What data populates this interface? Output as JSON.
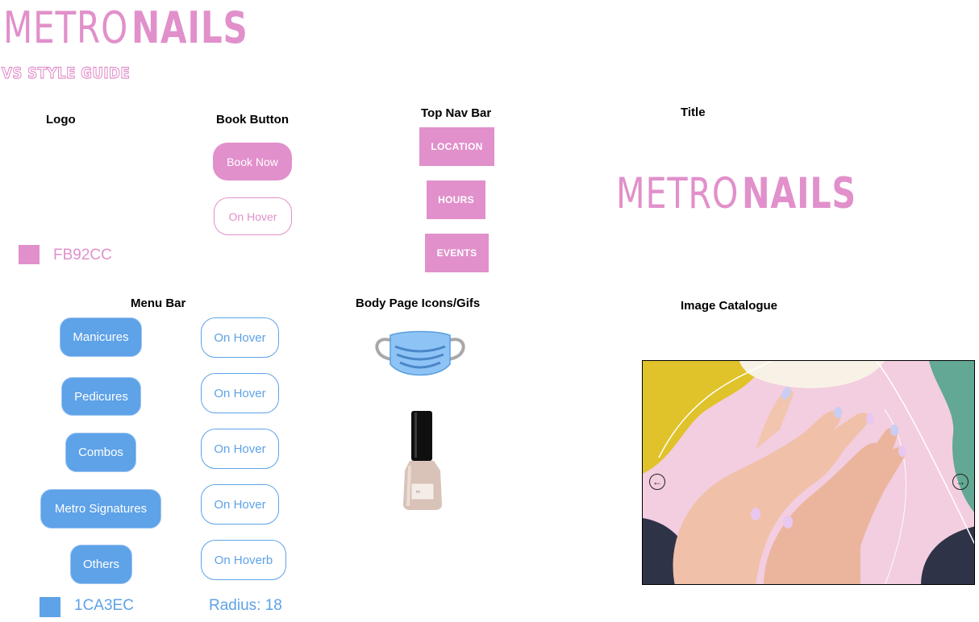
{
  "brand": {
    "logo_thin": "METRO",
    "logo_bold": "NAILS",
    "subtitle": "VS STYLE GUIDE"
  },
  "sections": {
    "logo": "Logo",
    "book_button": "Book Button",
    "top_nav_bar": "Top Nav Bar",
    "title": "Title",
    "menu_bar": "Menu Bar",
    "body_icons": "Body Page Icons/Gifs",
    "image_catalogue": "Image Catalogue"
  },
  "book": {
    "primary_label": "Book Now",
    "hover_label": "On Hover"
  },
  "top_nav": [
    "LOCATION",
    "HOURS",
    "EVENTS"
  ],
  "title_logo": {
    "thin": "METRO",
    "bold": "NAILS"
  },
  "colors": {
    "pink": "#e190cb",
    "pink_label": "FB92CC",
    "blue": "#5ea2e8",
    "blue_label": "1CA3EC"
  },
  "menu": {
    "items": [
      "Manicures",
      "Pedicures",
      "Combos",
      "Metro Signatures",
      "Others"
    ],
    "hover_labels": [
      "On Hover",
      "On Hover",
      "On Hover",
      "On Hover",
      "On Hoverb"
    ],
    "radius_label": "Radius: 18"
  },
  "icons": [
    "face-mask-icon",
    "nail-polish-icon",
    "arrow-left-icon",
    "arrow-right-icon"
  ]
}
